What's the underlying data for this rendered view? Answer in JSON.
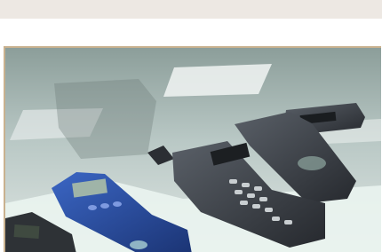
{
  "colors": {
    "topbar": "#ede8e3",
    "frame": "#c9b18f",
    "glass": "#a7b6b3",
    "phone_blue": "#2a4f9e",
    "phone_dark": "#3a3e44"
  },
  "photo": {
    "alt": "",
    "icon": "photo-image"
  }
}
